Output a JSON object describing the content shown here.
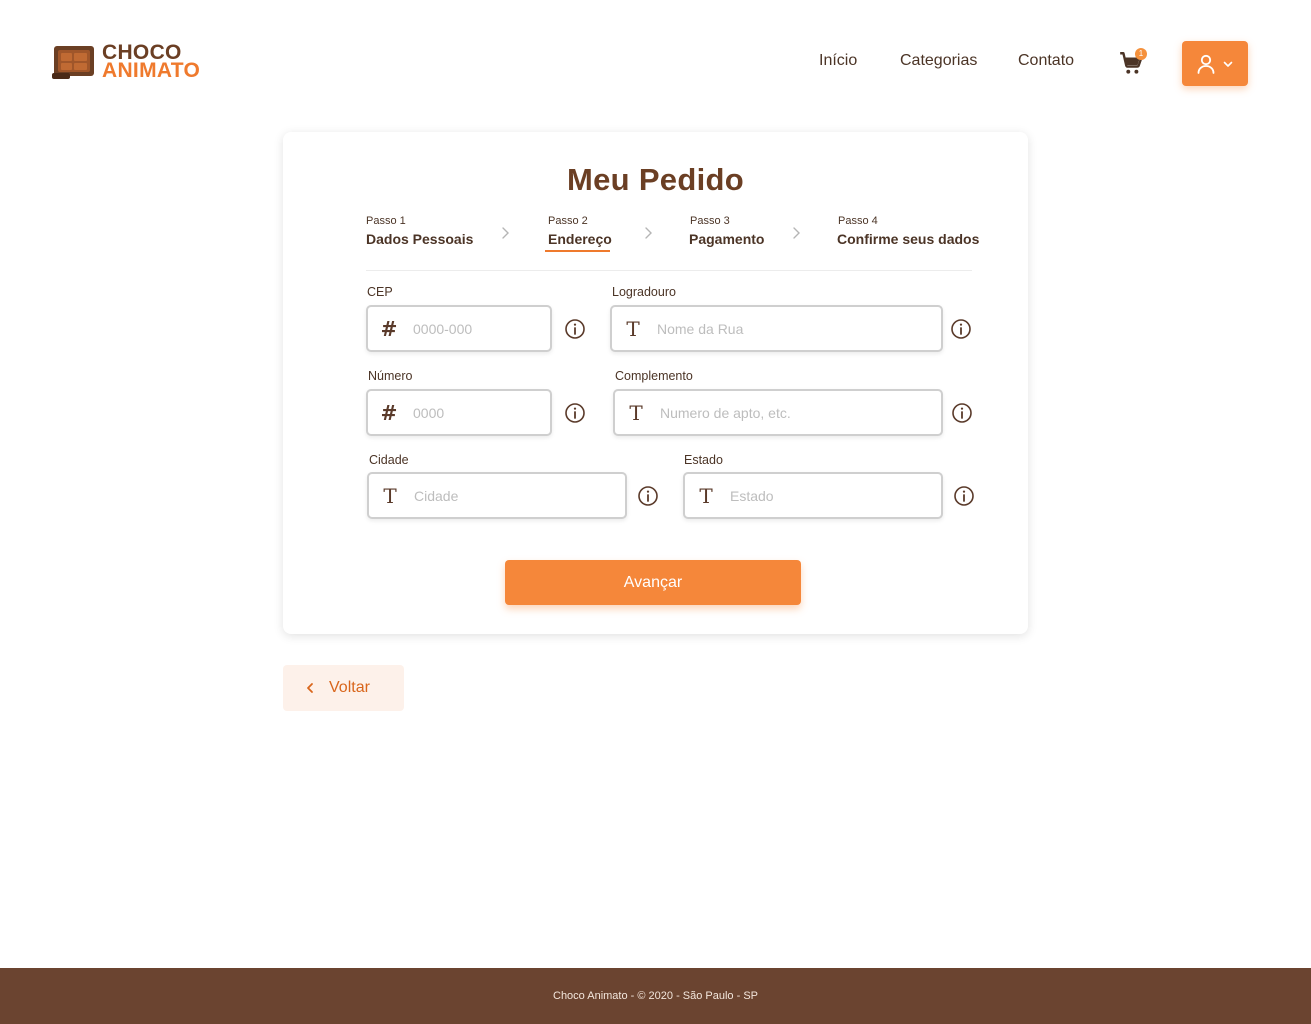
{
  "brand": {
    "line1": "CHOCO",
    "line2": "ANIMATO",
    "logo_icon": "chocolate-bar-logo"
  },
  "nav": {
    "items": [
      "Início",
      "Categorias",
      "Contato"
    ],
    "cart_count": "1",
    "cart_icon": "cart-icon",
    "user_icon": "user-icon"
  },
  "page": {
    "title": "Meu Pedido"
  },
  "steps": [
    {
      "small": "Passo 1",
      "label": "Dados Pessoais"
    },
    {
      "small": "Passo 2",
      "label": "Endereço",
      "active": true
    },
    {
      "small": "Passo 3",
      "label": "Pagamento"
    },
    {
      "small": "Passo 4",
      "label": "Confirme seus dados"
    }
  ],
  "form": {
    "cep": {
      "label": "CEP",
      "placeholder": "0000-000",
      "icon": "hash-icon"
    },
    "logradouro": {
      "label": "Logradouro",
      "placeholder": "Nome da Rua",
      "icon": "text-icon"
    },
    "numero": {
      "label": "Número",
      "placeholder": "0000",
      "icon": "hash-icon"
    },
    "complemento": {
      "label": "Complemento",
      "placeholder": "Numero de apto, etc.",
      "icon": "text-icon"
    },
    "cidade": {
      "label": "Cidade",
      "placeholder": "Cidade",
      "icon": "text-icon"
    },
    "estado": {
      "label": "Estado",
      "placeholder": "Estado",
      "icon": "text-icon"
    },
    "submit_label": "Avançar"
  },
  "back": {
    "label": "Voltar"
  },
  "footer": {
    "text": "Choco Animato - © 2020 - São Paulo - SP"
  },
  "colors": {
    "accent": "#f5873a",
    "brown": "#6b3f24",
    "footer_bg": "#6b4430"
  }
}
